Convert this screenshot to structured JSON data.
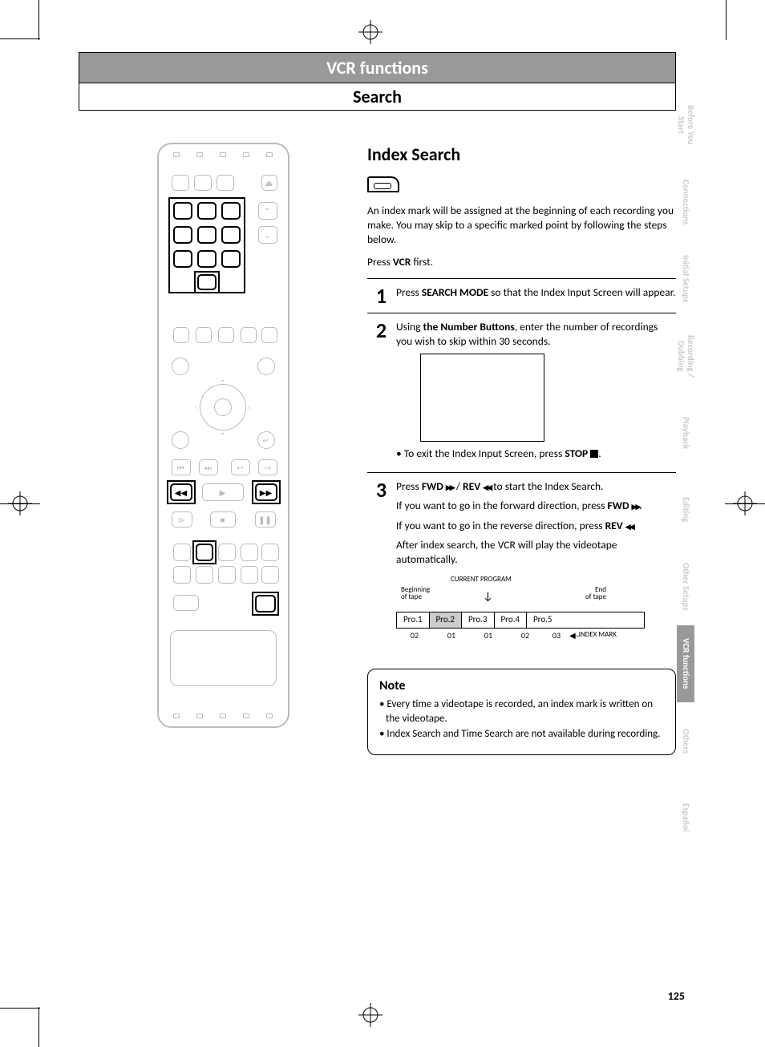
{
  "header": {
    "title": "VCR functions",
    "subtitle": "Search"
  },
  "section": {
    "heading": "Index Search",
    "intro": "An index mark will be assigned at the beginning of each recording you make. You may skip to a specific marked point by following the steps below.",
    "press_first_pre": "Press ",
    "press_first_bold": "VCR",
    "press_first_post": " first."
  },
  "steps": {
    "s1": {
      "num": "1",
      "pre": "Press ",
      "bold": "SEARCH MODE",
      "post": " so that the Index Input Screen will appear."
    },
    "s2": {
      "num": "2",
      "pre": "Using ",
      "bold": "the Number Buttons",
      "post": ", enter the number of recordings you wish to skip within 30 seconds.",
      "exit_pre": "• To exit the Index Input Screen, press ",
      "exit_bold": "STOP",
      "exit_post": "."
    },
    "s3": {
      "num": "3",
      "l1_pre": "Press ",
      "l1_b1": "FWD",
      "l1_mid": " / ",
      "l1_b2": "REV",
      "l1_post": " to start the Index Search.",
      "l2_pre": "If you want to go in the forward direction, press ",
      "l2_bold": "FWD",
      "l2_post": ".",
      "l3_pre": "If you want to go in the reverse direction, press ",
      "l3_bold": "REV",
      "l3_post": ".",
      "l4": "After index search, the VCR will play the videotape automatically."
    }
  },
  "tape": {
    "current": "CURRENT PROGRAM",
    "begin_l1": "Beginning",
    "begin_l2": "of tape",
    "end_l1": "End",
    "end_l2": "of tape",
    "cells": {
      "c1": "Pro.1",
      "c2": "Pro.2",
      "c3": "Pro.3",
      "c4": "Pro.4",
      "c5": "Pro.5"
    },
    "marks": {
      "m1": "02",
      "m2": "01",
      "m3": "01",
      "m4": "02",
      "m5": "03"
    },
    "index_label": "INDEX MARK"
  },
  "note": {
    "title": "Note",
    "n1": "Every time a videotape is recorded, an index mark is written on the videotape.",
    "n2": "Index Search and Time Search are not available during recording."
  },
  "tabs": {
    "t1": "Before You Start",
    "t2": "Connections",
    "t3": "Initial Setups",
    "t4": "Recording / Dubbing",
    "t5": "Playback",
    "t6": "Editing",
    "t7": "Other Setups",
    "t8": "VCR functions",
    "t9": "Others",
    "t10": "Español"
  },
  "page_number": "125"
}
